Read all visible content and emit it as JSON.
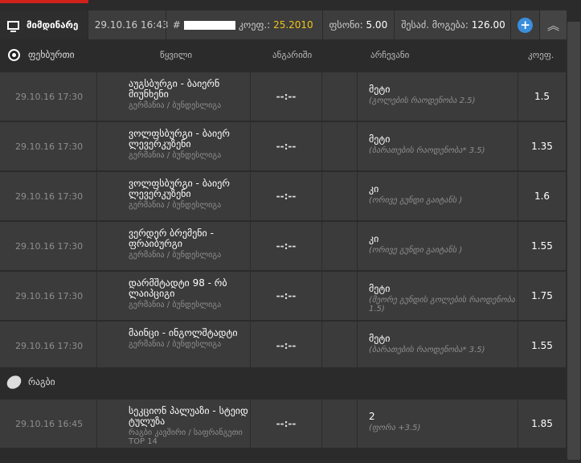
{
  "header": {
    "live_label": "მიმდინარე",
    "datetime": "29.10.16 16:43",
    "ticket_prefix": "#",
    "coef_label": "კოეფ.:",
    "coef_value": "25.2010",
    "price_label": "ფსონი:",
    "price_value": "5.00",
    "win_label": "შესაძ. მოგება:",
    "win_value": "126.00",
    "plus_icon": "plus-icon",
    "collapse_icon": "chevron-up-double-icon"
  },
  "columns": {
    "event": "წყვილი",
    "score": "ანგარიში",
    "pick": "არჩევანი",
    "odds": "კოეფ."
  },
  "sections": [
    {
      "name": "ფეხბურთი",
      "icon": "soccer-ball-icon",
      "rows": [
        {
          "time": "29.10.16 17:30",
          "match": "აუგსბურგი - ბაიერნ მიუნხენი",
          "league": "გერმანია / ბუნდესლიგა",
          "score": "--:--",
          "pick": "მეტი",
          "pick_desc": "(გოლების რაოდენობა 2.5)",
          "odd": "1.5"
        },
        {
          "time": "29.10.16 17:30",
          "match": "ვოლფსბურგი - ბაიერ ლევერკუზენი",
          "league": "გერმანია / ბუნდესლიგა",
          "score": "--:--",
          "pick": "მეტი",
          "pick_desc": "(ბარათების რაოდენობა* 3.5)",
          "odd": "1.35"
        },
        {
          "time": "29.10.16 17:30",
          "match": "ვოლფსბურგი - ბაიერ ლევერკუზენი",
          "league": "გერმანია / ბუნდესლიგა",
          "score": "--:--",
          "pick": "კი",
          "pick_desc": "(ორივე გუნდი გაიტანს )",
          "odd": "1.6"
        },
        {
          "time": "29.10.16 17:30",
          "match": "ვერდერ ბრემენი - ფრაიბურგი",
          "league": "გერმანია / ბუნდესლიგა",
          "score": "--:--",
          "pick": "კი",
          "pick_desc": "(ორივე გუნდი გაიტანს )",
          "odd": "1.55"
        },
        {
          "time": "29.10.16 17:30",
          "match": "დარმშტადტი 98 - რბ ლაიპციგი",
          "league": "გერმანია / ბუნდესლიგა",
          "score": "--:--",
          "pick": "მეტი",
          "pick_desc": "(მეორე გუნდის გოლების რაოდენობა 1.5)",
          "odd": "1.75"
        },
        {
          "time": "29.10.16 17:30",
          "match": "მაინცი - ინგოლშტადტი",
          "league": "გერმანია / ბუნდესლიგა",
          "score": "--:--",
          "pick": "მეტი",
          "pick_desc": "(ბარათების რაოდენობა* 3.5)",
          "odd": "1.55"
        }
      ]
    },
    {
      "name": "რაგბი",
      "icon": "rugby-ball-icon",
      "rows": [
        {
          "time": "29.10.16 16:45",
          "match": "სეკციონ პალუაზი - სტეიდ ტულუზა",
          "league": "რაგბი კავშირი / საფრანგეთი TOP 14",
          "score": "--:--",
          "pick": "2",
          "pick_desc": "(ფორა +3.5)",
          "odd": "1.85"
        }
      ]
    }
  ]
}
